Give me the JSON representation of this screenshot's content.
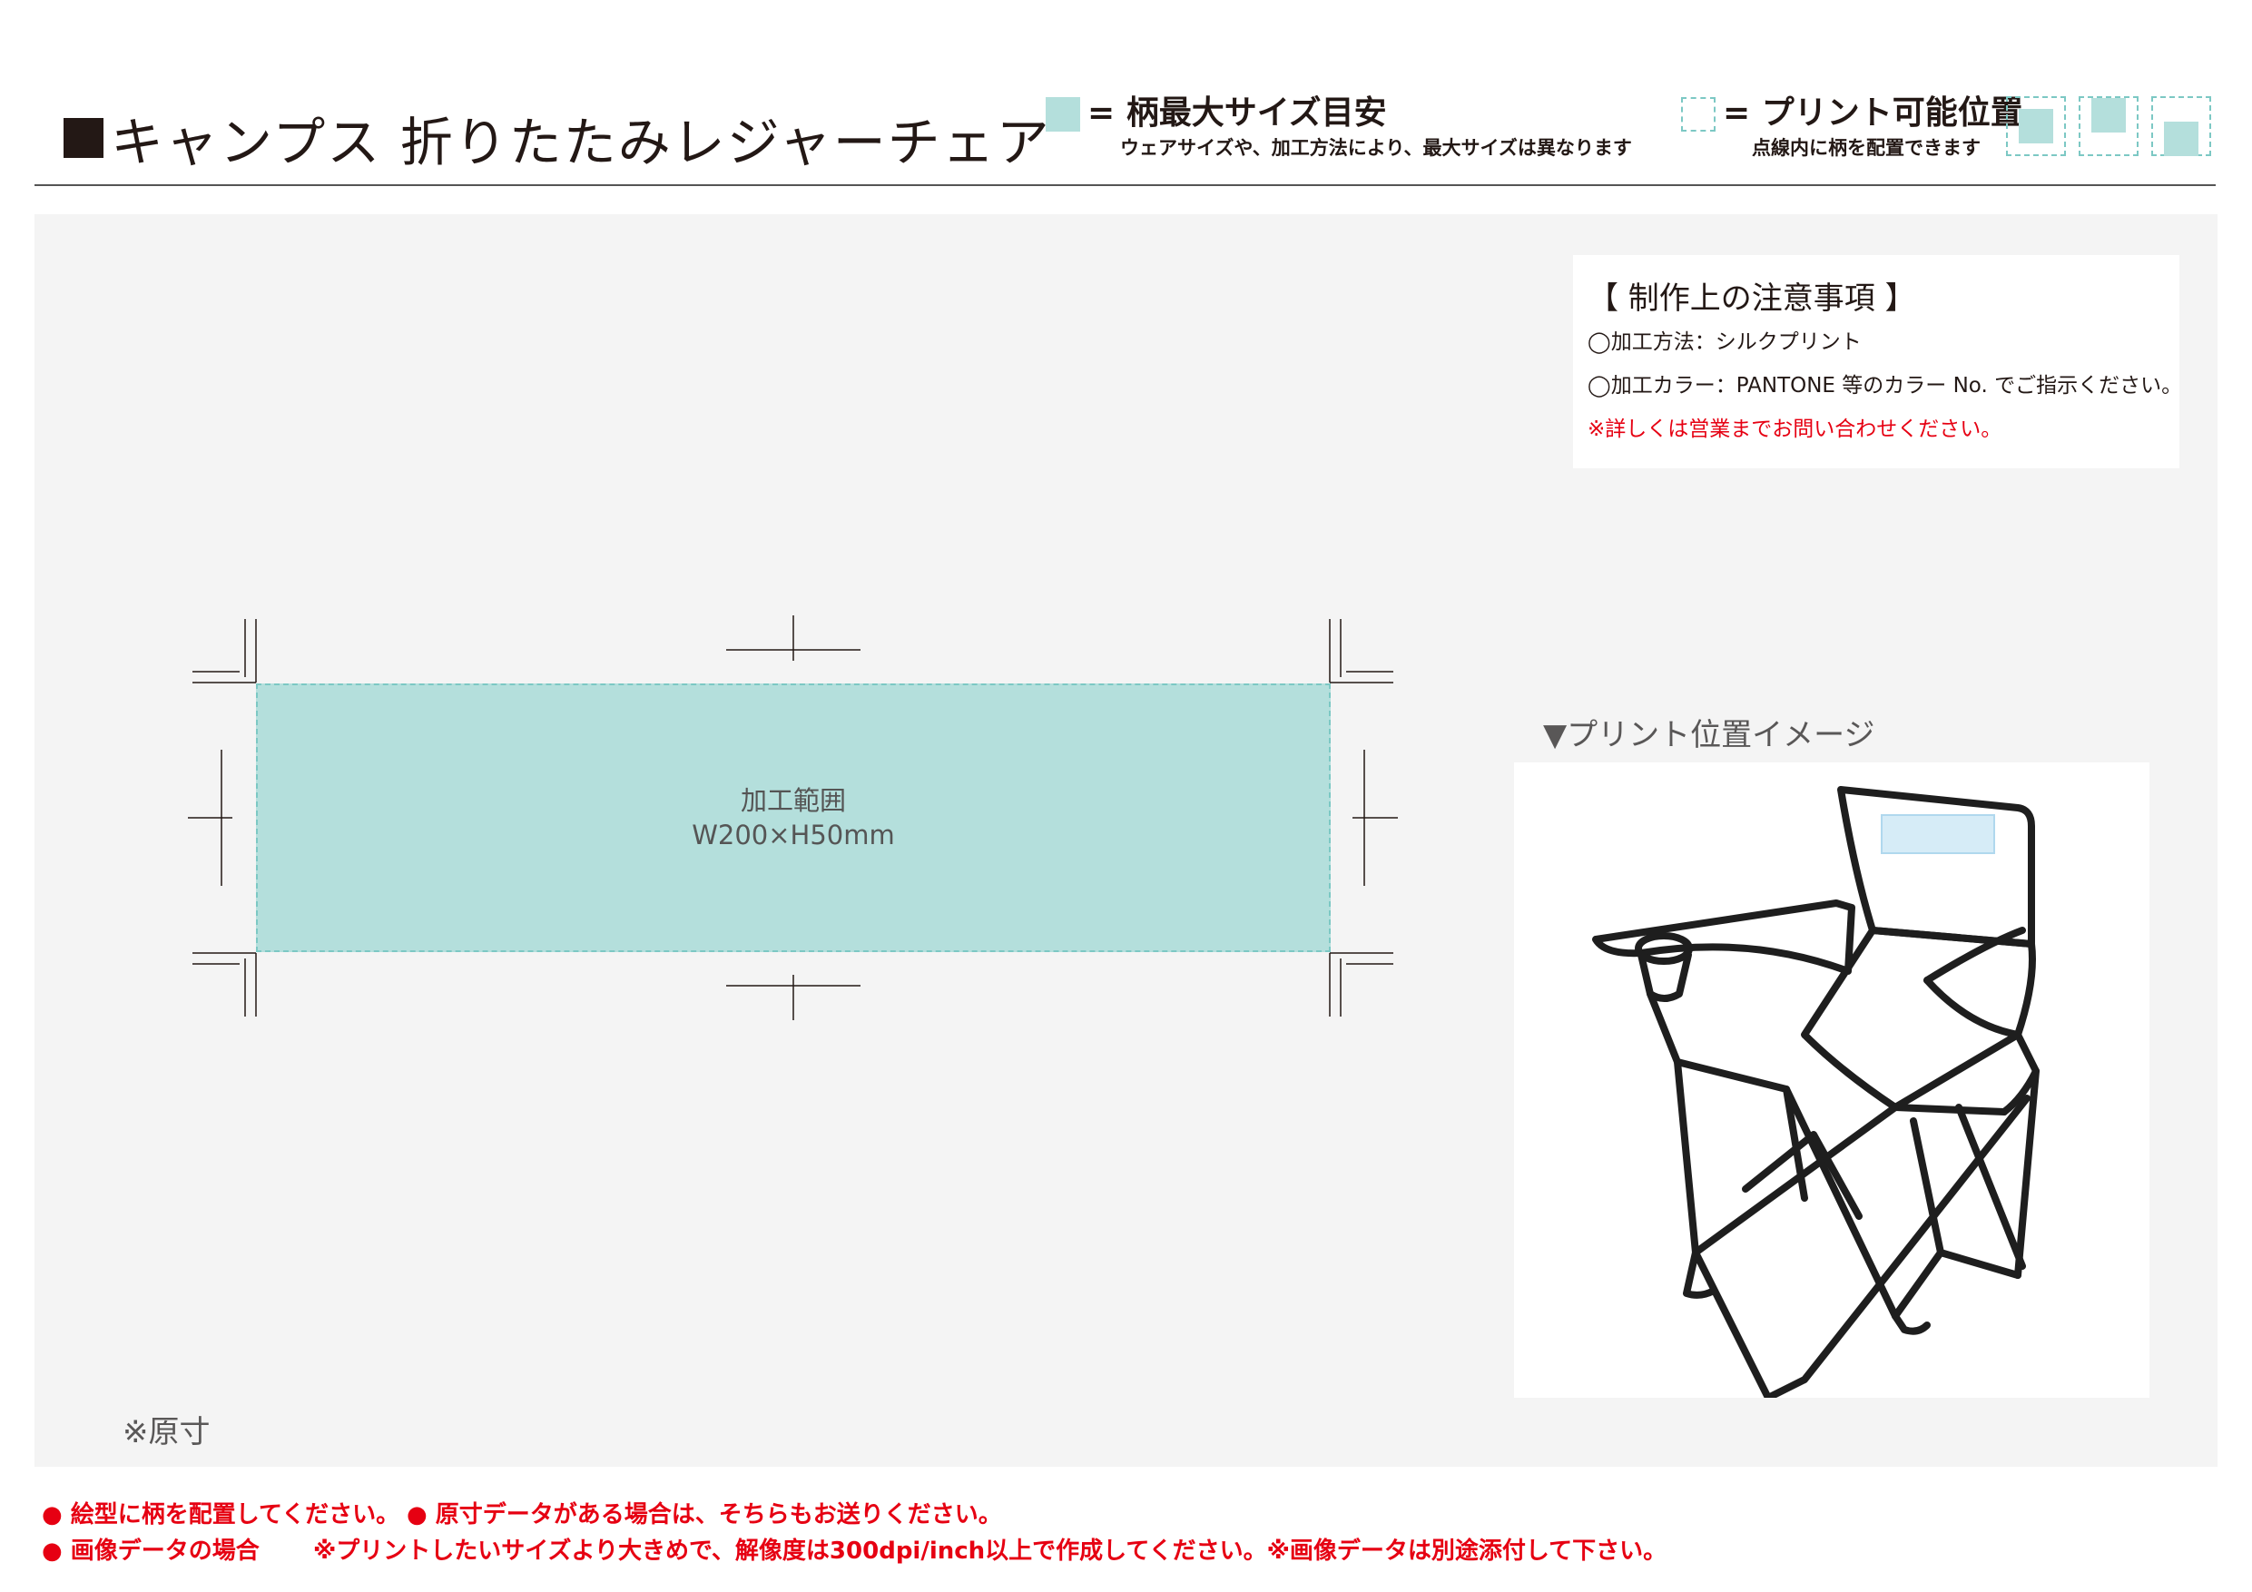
{
  "header": {
    "title": "キャンプス 折りたたみレジャーチェア",
    "legend_pattern_title": "= 柄最大サイズ目安",
    "legend_pattern_note": "ウェアサイズや、加工方法により、最大サイズは異なります",
    "legend_print_title": "= プリント可能位置",
    "legend_print_note": "点線内に柄を配置できます"
  },
  "notes": {
    "heading": "【 制作上の注意事項 】",
    "method": "◯加工方法：シルクプリント",
    "color": "◯加工カラー：PANTONE 等のカラー No. でご指示ください。",
    "contact": "※詳しくは営業までお問い合わせください。"
  },
  "print_area": {
    "label": "加工範囲",
    "size": "W200×H50mm"
  },
  "preview": {
    "label": "▼プリント位置イメージ"
  },
  "scale_note": "※原寸",
  "footer": {
    "line1_a": "● 絵型に柄を配置してください。",
    "line1_b": "● 原寸データがある場合は、そちらもお送りください。",
    "line2_a": "● 画像データの場合",
    "line2_b": "※プリントしたいサイズより大きめで、解像度は300dpi/inch以上で作成してください。※画像データは別途添付して下さい。"
  },
  "colors": {
    "pattern_fill": "#b4dfdc",
    "dashed_border": "#7cc8c4",
    "warning_red": "#e60012",
    "panel_bg": "#f4f4f4"
  }
}
